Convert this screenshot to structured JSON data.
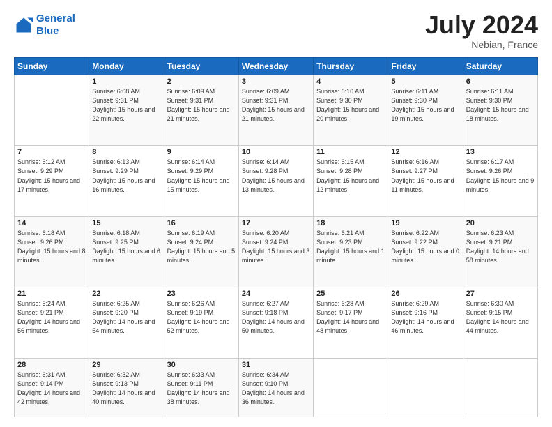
{
  "header": {
    "logo_line1": "General",
    "logo_line2": "Blue",
    "month_year": "July 2024",
    "location": "Nebian, France"
  },
  "weekdays": [
    "Sunday",
    "Monday",
    "Tuesday",
    "Wednesday",
    "Thursday",
    "Friday",
    "Saturday"
  ],
  "weeks": [
    [
      {
        "day": "",
        "sunrise": "",
        "sunset": "",
        "daylight": ""
      },
      {
        "day": "1",
        "sunrise": "Sunrise: 6:08 AM",
        "sunset": "Sunset: 9:31 PM",
        "daylight": "Daylight: 15 hours and 22 minutes."
      },
      {
        "day": "2",
        "sunrise": "Sunrise: 6:09 AM",
        "sunset": "Sunset: 9:31 PM",
        "daylight": "Daylight: 15 hours and 21 minutes."
      },
      {
        "day": "3",
        "sunrise": "Sunrise: 6:09 AM",
        "sunset": "Sunset: 9:31 PM",
        "daylight": "Daylight: 15 hours and 21 minutes."
      },
      {
        "day": "4",
        "sunrise": "Sunrise: 6:10 AM",
        "sunset": "Sunset: 9:30 PM",
        "daylight": "Daylight: 15 hours and 20 minutes."
      },
      {
        "day": "5",
        "sunrise": "Sunrise: 6:11 AM",
        "sunset": "Sunset: 9:30 PM",
        "daylight": "Daylight: 15 hours and 19 minutes."
      },
      {
        "day": "6",
        "sunrise": "Sunrise: 6:11 AM",
        "sunset": "Sunset: 9:30 PM",
        "daylight": "Daylight: 15 hours and 18 minutes."
      }
    ],
    [
      {
        "day": "7",
        "sunrise": "Sunrise: 6:12 AM",
        "sunset": "Sunset: 9:29 PM",
        "daylight": "Daylight: 15 hours and 17 minutes."
      },
      {
        "day": "8",
        "sunrise": "Sunrise: 6:13 AM",
        "sunset": "Sunset: 9:29 PM",
        "daylight": "Daylight: 15 hours and 16 minutes."
      },
      {
        "day": "9",
        "sunrise": "Sunrise: 6:14 AM",
        "sunset": "Sunset: 9:29 PM",
        "daylight": "Daylight: 15 hours and 15 minutes."
      },
      {
        "day": "10",
        "sunrise": "Sunrise: 6:14 AM",
        "sunset": "Sunset: 9:28 PM",
        "daylight": "Daylight: 15 hours and 13 minutes."
      },
      {
        "day": "11",
        "sunrise": "Sunrise: 6:15 AM",
        "sunset": "Sunset: 9:28 PM",
        "daylight": "Daylight: 15 hours and 12 minutes."
      },
      {
        "day": "12",
        "sunrise": "Sunrise: 6:16 AM",
        "sunset": "Sunset: 9:27 PM",
        "daylight": "Daylight: 15 hours and 11 minutes."
      },
      {
        "day": "13",
        "sunrise": "Sunrise: 6:17 AM",
        "sunset": "Sunset: 9:26 PM",
        "daylight": "Daylight: 15 hours and 9 minutes."
      }
    ],
    [
      {
        "day": "14",
        "sunrise": "Sunrise: 6:18 AM",
        "sunset": "Sunset: 9:26 PM",
        "daylight": "Daylight: 15 hours and 8 minutes."
      },
      {
        "day": "15",
        "sunrise": "Sunrise: 6:18 AM",
        "sunset": "Sunset: 9:25 PM",
        "daylight": "Daylight: 15 hours and 6 minutes."
      },
      {
        "day": "16",
        "sunrise": "Sunrise: 6:19 AM",
        "sunset": "Sunset: 9:24 PM",
        "daylight": "Daylight: 15 hours and 5 minutes."
      },
      {
        "day": "17",
        "sunrise": "Sunrise: 6:20 AM",
        "sunset": "Sunset: 9:24 PM",
        "daylight": "Daylight: 15 hours and 3 minutes."
      },
      {
        "day": "18",
        "sunrise": "Sunrise: 6:21 AM",
        "sunset": "Sunset: 9:23 PM",
        "daylight": "Daylight: 15 hours and 1 minute."
      },
      {
        "day": "19",
        "sunrise": "Sunrise: 6:22 AM",
        "sunset": "Sunset: 9:22 PM",
        "daylight": "Daylight: 15 hours and 0 minutes."
      },
      {
        "day": "20",
        "sunrise": "Sunrise: 6:23 AM",
        "sunset": "Sunset: 9:21 PM",
        "daylight": "Daylight: 14 hours and 58 minutes."
      }
    ],
    [
      {
        "day": "21",
        "sunrise": "Sunrise: 6:24 AM",
        "sunset": "Sunset: 9:21 PM",
        "daylight": "Daylight: 14 hours and 56 minutes."
      },
      {
        "day": "22",
        "sunrise": "Sunrise: 6:25 AM",
        "sunset": "Sunset: 9:20 PM",
        "daylight": "Daylight: 14 hours and 54 minutes."
      },
      {
        "day": "23",
        "sunrise": "Sunrise: 6:26 AM",
        "sunset": "Sunset: 9:19 PM",
        "daylight": "Daylight: 14 hours and 52 minutes."
      },
      {
        "day": "24",
        "sunrise": "Sunrise: 6:27 AM",
        "sunset": "Sunset: 9:18 PM",
        "daylight": "Daylight: 14 hours and 50 minutes."
      },
      {
        "day": "25",
        "sunrise": "Sunrise: 6:28 AM",
        "sunset": "Sunset: 9:17 PM",
        "daylight": "Daylight: 14 hours and 48 minutes."
      },
      {
        "day": "26",
        "sunrise": "Sunrise: 6:29 AM",
        "sunset": "Sunset: 9:16 PM",
        "daylight": "Daylight: 14 hours and 46 minutes."
      },
      {
        "day": "27",
        "sunrise": "Sunrise: 6:30 AM",
        "sunset": "Sunset: 9:15 PM",
        "daylight": "Daylight: 14 hours and 44 minutes."
      }
    ],
    [
      {
        "day": "28",
        "sunrise": "Sunrise: 6:31 AM",
        "sunset": "Sunset: 9:14 PM",
        "daylight": "Daylight: 14 hours and 42 minutes."
      },
      {
        "day": "29",
        "sunrise": "Sunrise: 6:32 AM",
        "sunset": "Sunset: 9:13 PM",
        "daylight": "Daylight: 14 hours and 40 minutes."
      },
      {
        "day": "30",
        "sunrise": "Sunrise: 6:33 AM",
        "sunset": "Sunset: 9:11 PM",
        "daylight": "Daylight: 14 hours and 38 minutes."
      },
      {
        "day": "31",
        "sunrise": "Sunrise: 6:34 AM",
        "sunset": "Sunset: 9:10 PM",
        "daylight": "Daylight: 14 hours and 36 minutes."
      },
      {
        "day": "",
        "sunrise": "",
        "sunset": "",
        "daylight": ""
      },
      {
        "day": "",
        "sunrise": "",
        "sunset": "",
        "daylight": ""
      },
      {
        "day": "",
        "sunrise": "",
        "sunset": "",
        "daylight": ""
      }
    ]
  ]
}
